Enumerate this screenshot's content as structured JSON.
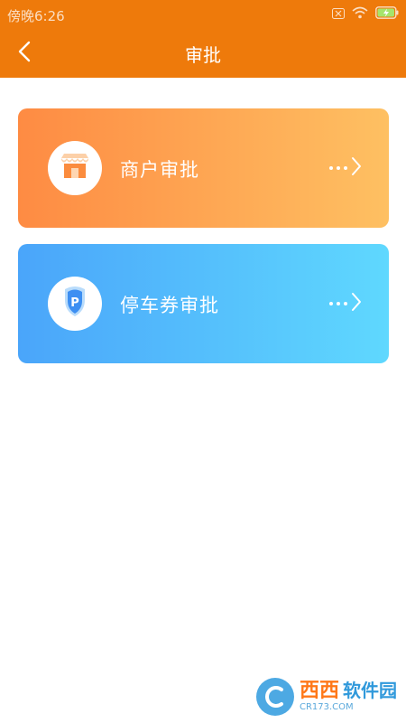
{
  "status_bar": {
    "time": "傍晚6:26",
    "icons": [
      "sim-off-icon",
      "wifi-icon",
      "battery-charging-icon"
    ]
  },
  "header": {
    "title": "审批",
    "back_icon": "chevron-left-icon",
    "background": "#ee7a0b"
  },
  "cards": [
    {
      "label": "商户审批",
      "icon": "store-icon",
      "gradient": [
        "#fe8b43",
        "#fec062"
      ],
      "more_icon": "more-dots-icon",
      "arrow_icon": "chevron-right-icon"
    },
    {
      "label": "停车券审批",
      "icon": "parking-shield-icon",
      "icon_letter": "P",
      "gradient": [
        "#4aa5fa",
        "#5fd8fe"
      ],
      "more_icon": "more-dots-icon",
      "arrow_icon": "chevron-right-icon"
    }
  ],
  "watermark": {
    "brand": "西西",
    "subtitle": "软件园",
    "url": "CR173.COM"
  }
}
